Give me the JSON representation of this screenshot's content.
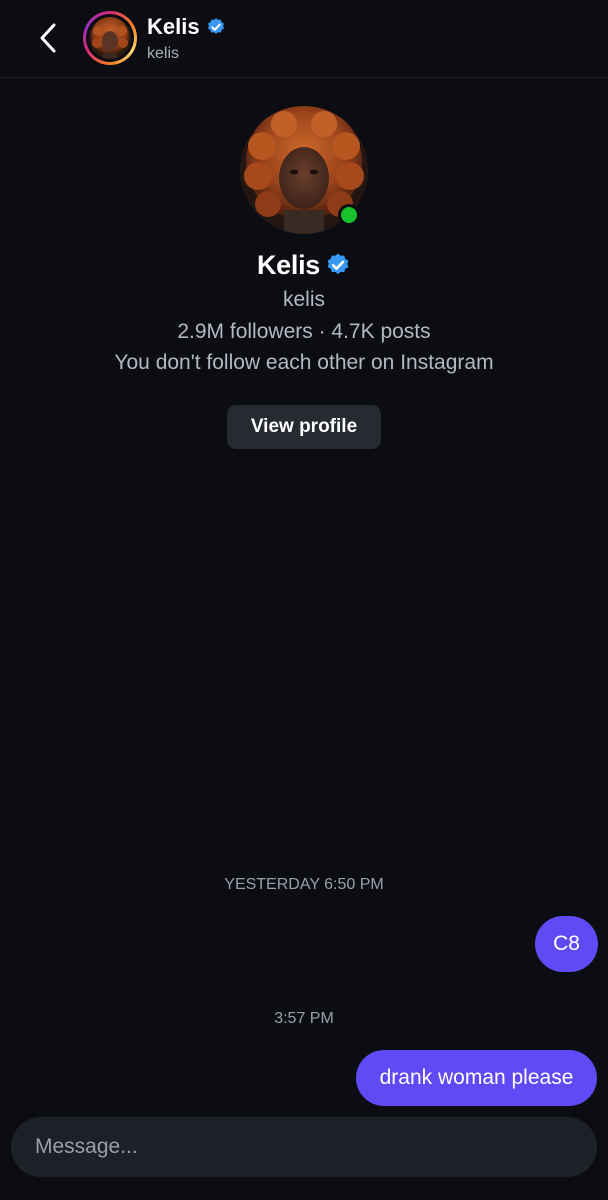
{
  "header": {
    "name": "Kelis",
    "username": "kelis",
    "verified_icon": "verified-badge-icon",
    "back_icon": "chevron-left-icon"
  },
  "profile": {
    "name": "Kelis",
    "username": "kelis",
    "stats": "2.9M followers · 4.7K posts",
    "relationship": "You don't follow each other on Instagram",
    "view_profile_label": "View profile",
    "online": true
  },
  "messages": [
    {
      "timestamp": "YESTERDAY 6:50 PM",
      "text": "C8",
      "outgoing": true
    },
    {
      "timestamp": "3:57 PM",
      "text": "drank woman please",
      "outgoing": true
    }
  ],
  "composer": {
    "placeholder": "Message..."
  },
  "colors": {
    "background": "#0b0d12",
    "bubble": "#6149f5",
    "verified": "#3897f0",
    "online": "#19c12a",
    "button": "#262a31"
  }
}
